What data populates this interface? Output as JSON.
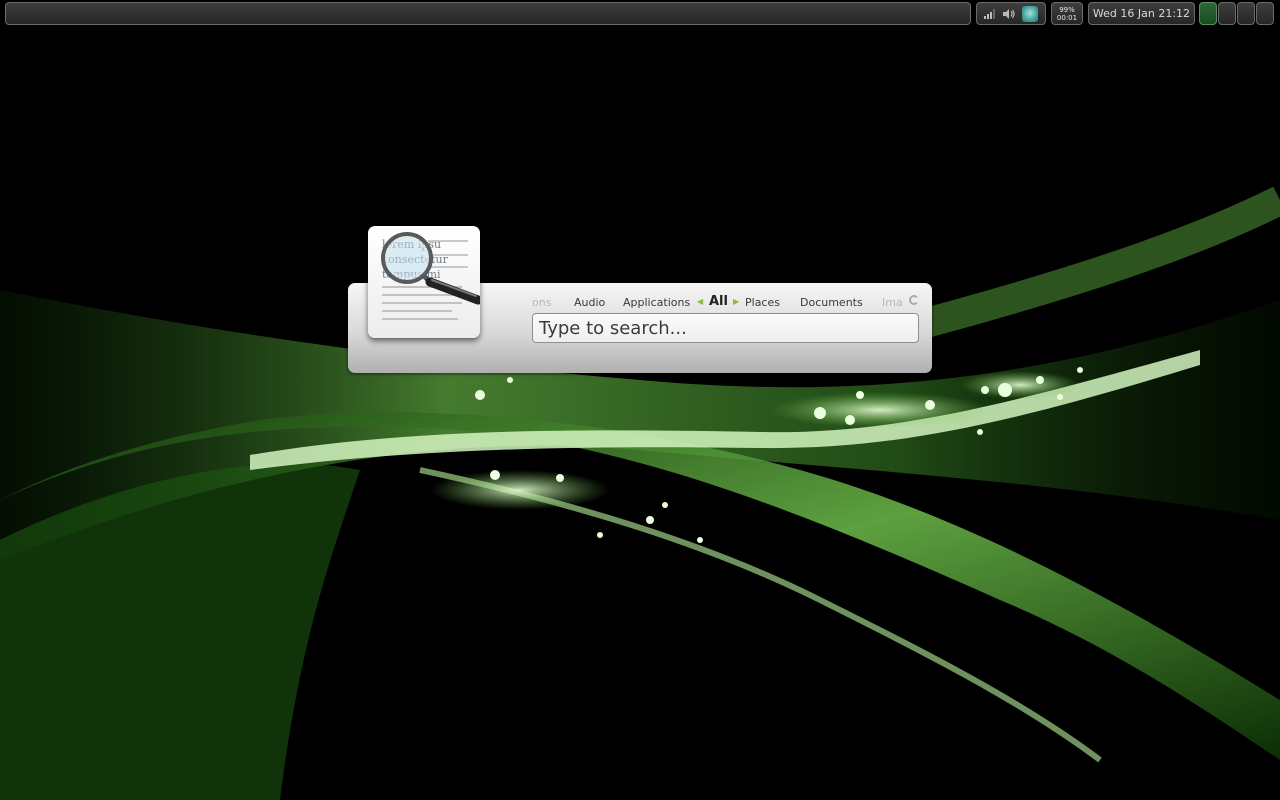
{
  "panel": {
    "battery_percent": "99%",
    "battery_time": "00:01",
    "clock": "Wed 16 Jan 21:12",
    "workspaces": [
      {
        "active": true
      },
      {
        "active": false
      },
      {
        "active": false
      },
      {
        "active": false
      }
    ],
    "tray_icons": [
      "network-signal-icon",
      "volume-icon",
      "app-indicator-icon"
    ]
  },
  "search": {
    "placeholder": "Type to search...",
    "scopes": {
      "partial_left": "ons",
      "audio": "Audio",
      "applications": "Applications",
      "all": "All",
      "places": "Places",
      "documents": "Documents",
      "partial_right": "Ima"
    },
    "selected_scope": "All"
  },
  "document_preview": {
    "line1": "lorem ipsu",
    "line2": "consectetur",
    "line3": "tempus mi"
  },
  "colors": {
    "accent_green": "#8cbc3a",
    "wallpaper_green": "#6fc04a"
  }
}
